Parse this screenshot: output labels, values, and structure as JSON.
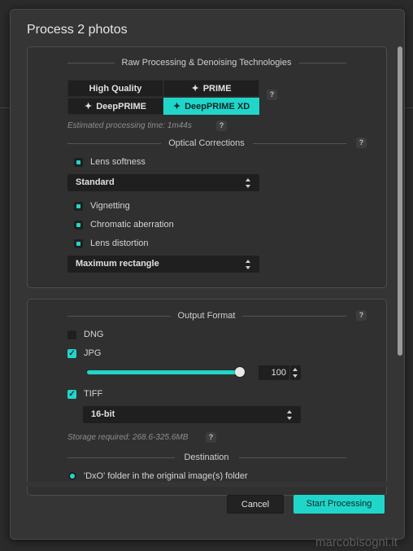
{
  "dialog": {
    "title": "Process 2 photos"
  },
  "raw": {
    "section_label": "Raw Processing & Denoising Technologies",
    "options": [
      "High Quality",
      "PRIME",
      "DeepPRIME",
      "DeepPRIME XD"
    ],
    "selected": "DeepPRIME XD",
    "help": "?",
    "estimate": "Estimated processing time: 1m44s",
    "estimate_help": "?"
  },
  "optical": {
    "section_label": "Optical Corrections",
    "help": "?",
    "lens_softness": "Lens softness",
    "softness_mode": "Standard",
    "vignetting": "Vignetting",
    "chromatic": "Chromatic aberration",
    "distortion": "Lens distortion",
    "distortion_mode": "Maximum rectangle"
  },
  "output": {
    "section_label": "Output Format",
    "help": "?",
    "dng": "DNG",
    "jpg": "JPG",
    "jpg_quality": "100",
    "jpg_quality_fraction": 1.0,
    "tiff": "TIFF",
    "tiff_depth": "16-bit",
    "storage": "Storage required: 268.6-325.6MB",
    "storage_help": "?",
    "destination_label": "Destination",
    "destination_option": "'DxO' folder in the original image(s) folder"
  },
  "buttons": {
    "cancel": "Cancel",
    "start": "Start Processing"
  },
  "watermark": "marcobisogni.it",
  "colors": {
    "accent": "#20d6ca",
    "dialog_bg": "#353535",
    "panel_bg": "#303030"
  },
  "icons": {
    "sparkle": "✦",
    "checkmark": "✓"
  }
}
